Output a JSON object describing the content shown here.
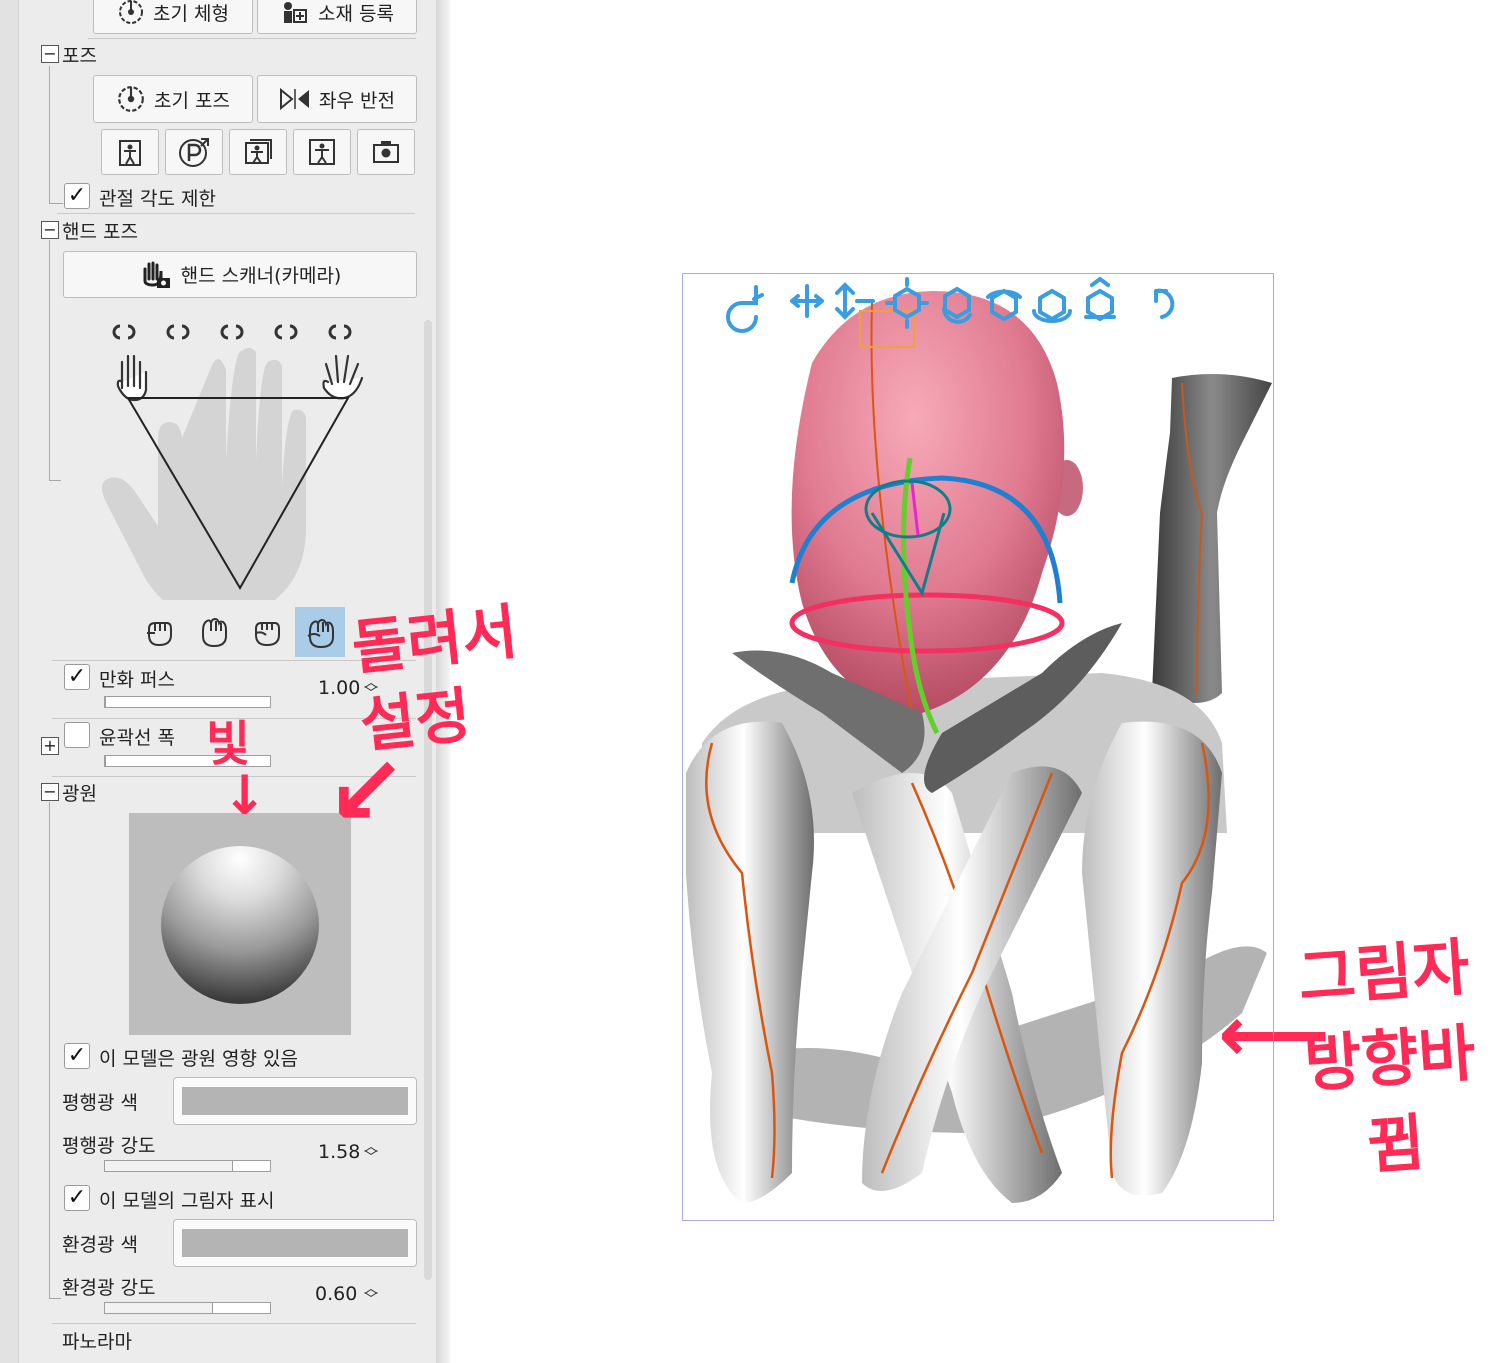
{
  "panel": {
    "top_buttons": {
      "reset_body": "초기 체형",
      "register_material": "소재 등록"
    },
    "pose": {
      "title": "포즈",
      "reset_pose": "초기 포즈",
      "flip": "좌우 반전",
      "icon_buttons": [
        "pose-preset-icon",
        "p-pose-icon",
        "photo-pose-icon",
        "figure-pose-icon",
        "camera-icon"
      ],
      "joint_limit": {
        "label": "관절 각도 제한",
        "checked": true
      }
    },
    "hand_pose": {
      "title": "핸드 포즈",
      "scanner_button": "핸드 스캐너(카메라)",
      "link_icons_count": 5,
      "grip_icons": [
        "fist-1-icon",
        "fist-2-icon",
        "fist-3-icon",
        "fist-4-icon"
      ],
      "selected_grip": 3
    },
    "manga_perspective": {
      "label": "만화 퍼스",
      "checked": true,
      "value": "1.00",
      "fill_fraction": 0.0
    },
    "outline_width": {
      "label": "윤곽선 폭",
      "checked": false,
      "fill_fraction": 0.0
    },
    "light": {
      "title": "광원",
      "affected": {
        "label": "이 모델은 광원 영향 있음",
        "checked": true
      },
      "directional_color_label": "평행광 색",
      "directional_color": "#b4b4b4",
      "directional_intensity": {
        "label": "평행광 강도",
        "value": "1.58",
        "fill_fraction": 0.79
      },
      "shadow": {
        "label": "이 모델의 그림자 표시",
        "checked": true
      },
      "ambient_color_label": "환경광 색",
      "ambient_color": "#b4b4b4",
      "ambient_intensity": {
        "label": "환경광 강도",
        "value": "0.60",
        "fill_fraction": 0.65
      }
    },
    "panorama": "파노라마"
  },
  "annotations": {
    "rotate_setting": "돌려서\n설정",
    "light_word": "빛",
    "arrow_down": "↓",
    "arrow_diag": "↙",
    "shadow_note": "그림자\n방향바\n뀜",
    "arrow_left": "⟵"
  },
  "colors": {
    "accent_blue": "#3a9de0",
    "annotation_red": "#ff2a55",
    "head_pink": "#e5849a",
    "selected_grip_bg": "#a9cce8"
  },
  "viewport": {
    "toolbar_icons": [
      "rotate-camera-icon",
      "move-xy-icon",
      "move-z-icon",
      "move-3d-icon",
      "rotate-x-icon",
      "rotate-y-icon",
      "rotate-z-icon",
      "drop-to-floor-icon",
      "reset-undo-icon"
    ]
  }
}
